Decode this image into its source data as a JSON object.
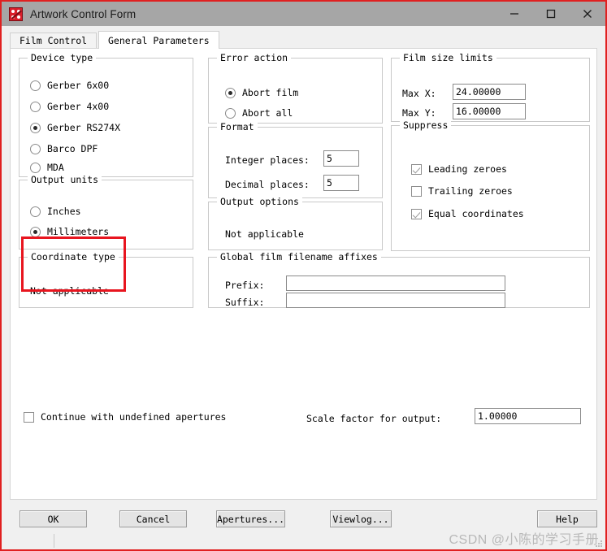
{
  "window": {
    "title": "Artwork Control Form",
    "icon": "artwork-app-icon",
    "controls": {
      "minimize": "minimize-icon",
      "maximize": "maximize-icon",
      "close": "close-icon"
    }
  },
  "tabs": [
    {
      "label": "Film Control",
      "active": false
    },
    {
      "label": "General Parameters",
      "active": true
    }
  ],
  "groups": {
    "device_type": {
      "legend": "Device type",
      "options": [
        {
          "label": "Gerber 6x00",
          "checked": false
        },
        {
          "label": "Gerber 4x00",
          "checked": false
        },
        {
          "label": "Gerber RS274X",
          "checked": true
        },
        {
          "label": "Barco DPF",
          "checked": false
        },
        {
          "label": "MDA",
          "checked": false
        }
      ]
    },
    "output_units": {
      "legend": "Output units",
      "options": [
        {
          "label": "Inches",
          "checked": false
        },
        {
          "label": "Millimeters",
          "checked": true
        }
      ]
    },
    "coordinate_type": {
      "legend": "Coordinate type",
      "note": "Not applicable"
    },
    "error_action": {
      "legend": "Error action",
      "options": [
        {
          "label": "Abort film",
          "checked": true
        },
        {
          "label": "Abort all",
          "checked": false
        }
      ]
    },
    "format": {
      "legend": "Format",
      "fields": [
        {
          "label": "Integer places:",
          "value": "5"
        },
        {
          "label": "Decimal places:",
          "value": "5"
        }
      ]
    },
    "output_options": {
      "legend": "Output options",
      "note": "Not applicable"
    },
    "film_size_limits": {
      "legend": "Film size limits",
      "fields": [
        {
          "label": "Max X:",
          "value": "24.00000"
        },
        {
          "label": "Max Y:",
          "value": "16.00000"
        }
      ]
    },
    "suppress": {
      "legend": "Suppress",
      "options": [
        {
          "label": "Leading zeroes",
          "checked": true
        },
        {
          "label": "Trailing zeroes",
          "checked": false
        },
        {
          "label": "Equal coordinates",
          "checked": true
        }
      ]
    },
    "filename_affixes": {
      "legend": "Global film filename affixes",
      "fields": [
        {
          "label": "Prefix:",
          "value": ""
        },
        {
          "label": "Suffix:",
          "value": ""
        }
      ]
    }
  },
  "bottom_controls": {
    "continue_undefined": {
      "label": "Continue with undefined apertures",
      "checked": false
    },
    "scale_factor": {
      "label": "Scale factor for output:",
      "value": "1.00000"
    }
  },
  "buttons": {
    "ok": "OK",
    "cancel": "Cancel",
    "apertures": "Apertures...",
    "viewlog": "Viewlog...",
    "help": "Help"
  },
  "watermark": "CSDN @小陈的学习手册",
  "colors": {
    "annotation": "#e8151f",
    "titlebar": "#a6a6a6",
    "panel": "#ffffff",
    "window_border": "#e02020"
  }
}
